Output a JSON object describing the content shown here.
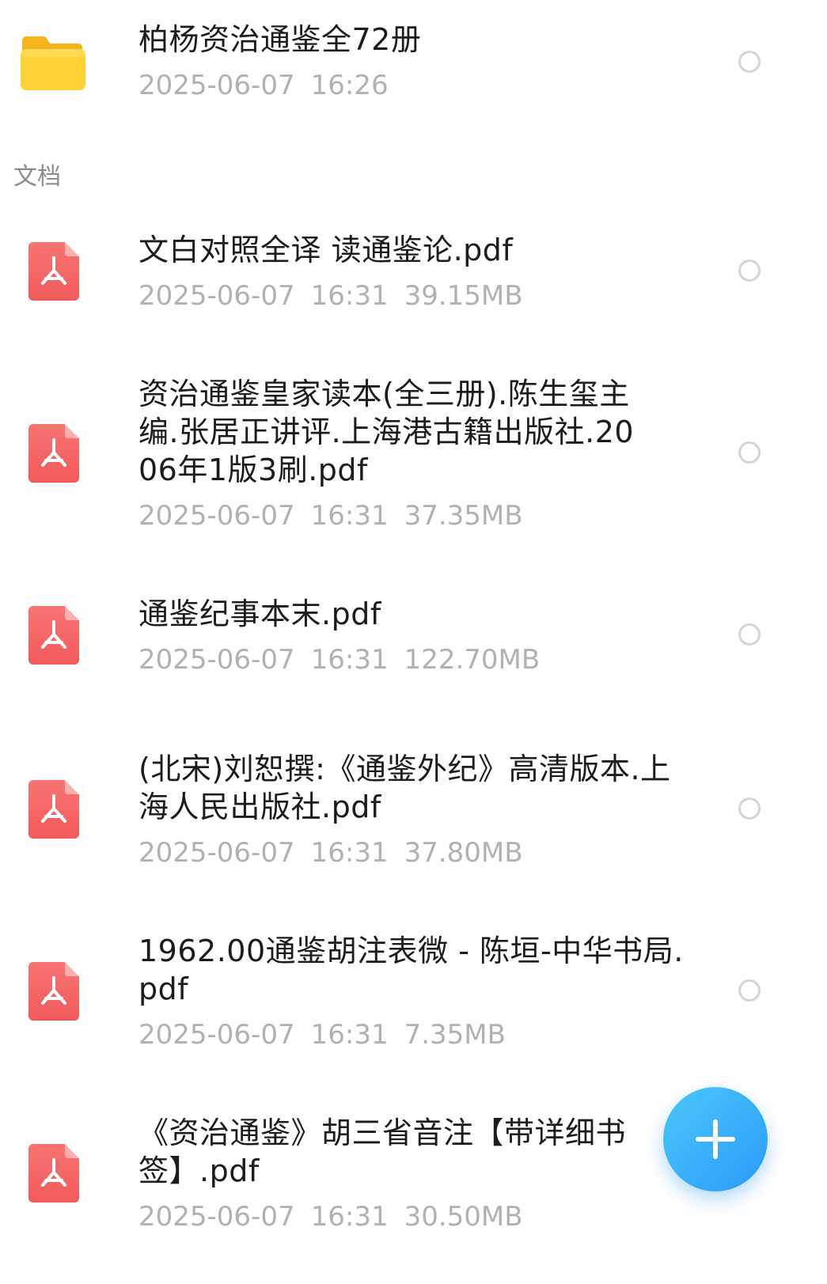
{
  "folder": {
    "name": "柏杨资治通鉴全72册",
    "date": "2025-06-07",
    "time": "16:26",
    "icon": "folder-icon"
  },
  "section": {
    "label": "文档"
  },
  "files": [
    {
      "name": "文白对照全译 读通鉴论.pdf",
      "date": "2025-06-07",
      "time": "16:31",
      "size": "39.15MB",
      "icon": "pdf-icon"
    },
    {
      "name": "资治通鉴皇家读本(全三册).陈生玺主编.张居正讲评.上海港古籍出版社.2006年1版3刷.pdf",
      "date": "2025-06-07",
      "time": "16:31",
      "size": "37.35MB",
      "icon": "pdf-icon"
    },
    {
      "name": "通鉴纪事本末.pdf",
      "date": "2025-06-07",
      "time": "16:31",
      "size": "122.70MB",
      "icon": "pdf-icon"
    },
    {
      "name": "(北宋)刘恕撰:《通鉴外纪》高清版本.上海人民出版社.pdf",
      "date": "2025-06-07",
      "time": "16:31",
      "size": "37.80MB",
      "icon": "pdf-icon"
    },
    {
      "name": "1962.00通鉴胡注表微 - 陈垣-中华书局.pdf",
      "date": "2025-06-07",
      "time": "16:31",
      "size": "7.35MB",
      "icon": "pdf-icon"
    },
    {
      "name": "《资治通鉴》胡三省音注【带详细书签】.pdf",
      "date": "2025-06-07",
      "time": "16:31",
      "size": "30.50MB",
      "icon": "pdf-icon"
    }
  ],
  "fab": {
    "icon": "plus-icon"
  },
  "colors": {
    "pdf_red": "#f25a5b",
    "folder_yellow": "#ffc82c",
    "fab_blue": "#2a9bf8",
    "meta_gray": "#b1b1b1"
  }
}
